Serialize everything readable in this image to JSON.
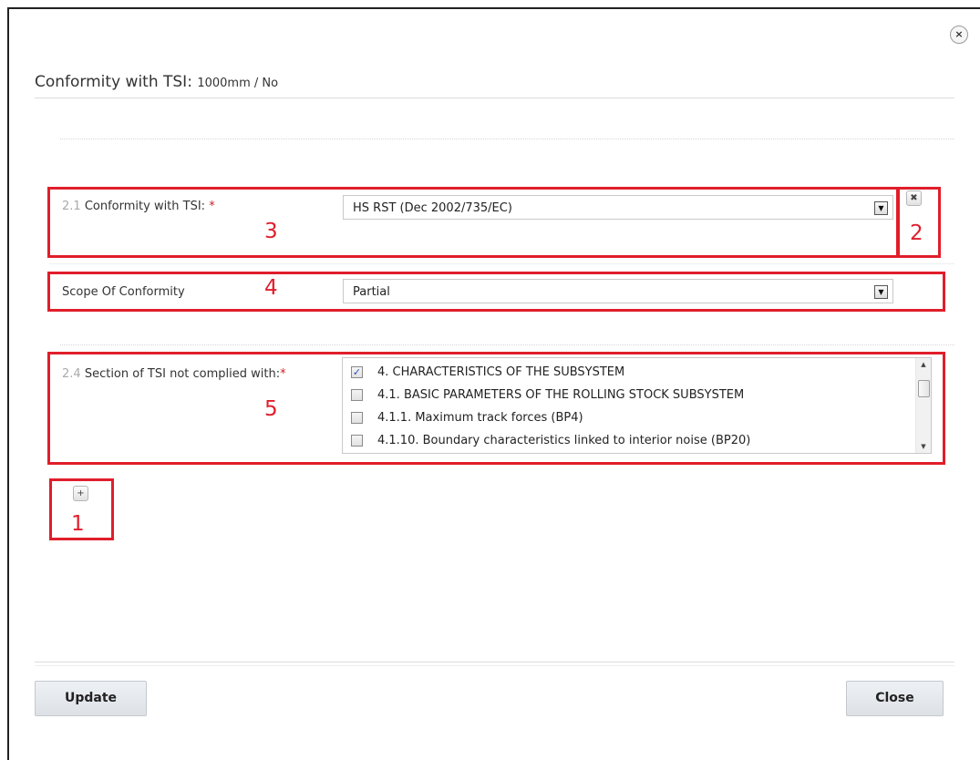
{
  "dialog": {
    "close_icon": "×",
    "title": "Conformity with TSI:",
    "subtitle": "1000mm / No"
  },
  "field_tsi": {
    "number": "2.1",
    "label": "Conformity with TSI:",
    "required": "*",
    "selected": "HS RST (Dec 2002/735/EC)",
    "remove_icon": "✖"
  },
  "field_scope": {
    "label": "Scope Of Conformity",
    "selected": "Partial"
  },
  "field_sections": {
    "number": "2.4",
    "label": "Section of TSI not complied with:",
    "required": "*",
    "items": [
      {
        "text": "4. CHARACTERISTICS OF THE SUBSYSTEM",
        "checked": true,
        "mark": "✓"
      },
      {
        "text": "4.1. BASIC PARAMETERS OF THE ROLLING STOCK SUBSYSTEM",
        "checked": false,
        "mark": ""
      },
      {
        "text": "4.1.1. Maximum track forces (BP4)",
        "checked": false,
        "mark": ""
      },
      {
        "text": "4.1.10. Boundary characteristics linked to interior noise (BP20)",
        "checked": false,
        "mark": ""
      }
    ]
  },
  "add_button": {
    "icon": "+"
  },
  "annotations": {
    "one": "1",
    "two": "2",
    "three": "3",
    "four": "4",
    "five": "5",
    "color": "#e01e2b"
  },
  "footer": {
    "update_label": "Update",
    "close_label": "Close"
  }
}
